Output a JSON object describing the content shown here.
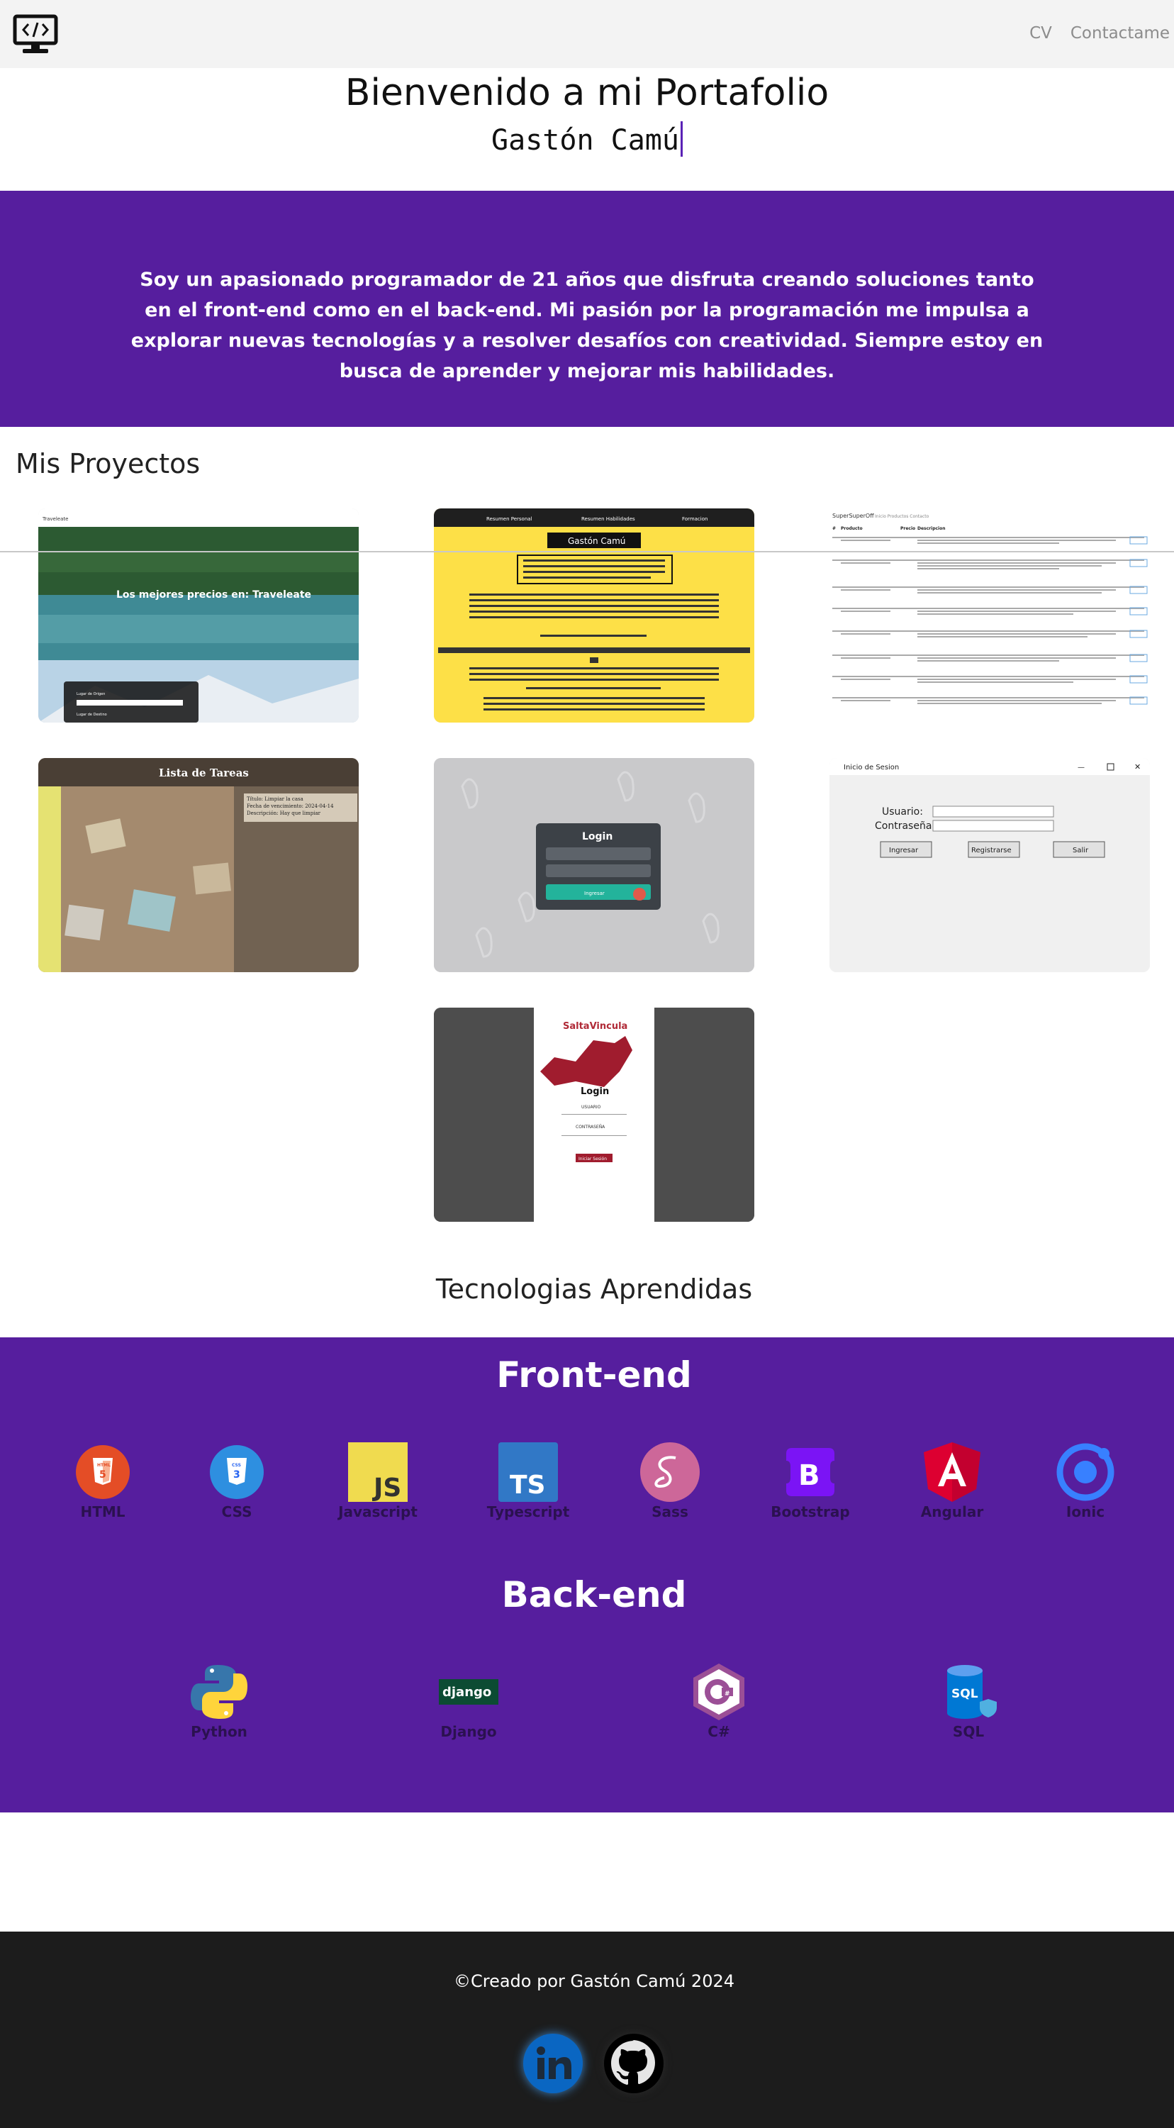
{
  "nav": {
    "logo_icon": "code-monitor-icon",
    "links": [
      "CV",
      "Contactame"
    ]
  },
  "hero": {
    "title": "Bienvenido a mi Portafolio",
    "name": "Gastón Camú"
  },
  "about": {
    "text": "Soy un apasionado programador de 21 años que disfruta creando soluciones tanto en el front-end como en el back-end. Mi pasión por la programación me impulsa a explorar nuevas tecnologías y a resolver desafíos con creatividad. Siempre estoy en busca de aprender y mejorar mis habilidades."
  },
  "projects": {
    "title": "Mis Proyectos",
    "items": [
      {
        "name": "traveleate",
        "hero_text": "Los mejores precios en: Traveleate",
        "brand": "Traveleate",
        "form_labels": [
          "Lugar de Origen",
          "Lugar de Destino"
        ]
      },
      {
        "name": "cv-page",
        "heading": "Gastón Camú",
        "tabs": [
          "Resumen Personal",
          "Resumen Habilidades",
          "Formacion"
        ]
      },
      {
        "name": "supersuperoff",
        "brand": "SuperSuperOff",
        "headers": [
          "#",
          "Producto",
          "Precio",
          "Descripcion"
        ]
      },
      {
        "name": "lista-tareas",
        "title": "Lista de Tareas",
        "fields": [
          "Título:",
          "Fecha de vencimiento:",
          "Descripción:"
        ]
      },
      {
        "name": "login-odontologia",
        "title": "Login",
        "button": "Ingresar"
      },
      {
        "name": "inicio-sesion",
        "window_title": "Inicio de Sesion",
        "labels": [
          "Usuario:",
          "Contraseña:"
        ],
        "buttons": [
          "Ingresar",
          "Registrarse",
          "Salir"
        ]
      },
      {
        "name": "saltavincula",
        "brand": "SaltaVincula",
        "title": "Login",
        "labels": [
          "USUARIO",
          "CONTRASEÑA"
        ],
        "button": "Iniciar Sesión"
      }
    ]
  },
  "tech": {
    "title": "Tecnologias Aprendidas",
    "frontend": {
      "title": "Front-end",
      "items": [
        {
          "label": "HTML",
          "icon": "html5-icon",
          "color": "#e44d26"
        },
        {
          "label": "CSS",
          "icon": "css3-icon",
          "color": "#2965f1"
        },
        {
          "label": "Javascript",
          "icon": "javascript-icon",
          "color": "#f0db4f"
        },
        {
          "label": "Typescript",
          "icon": "typescript-icon",
          "color": "#3178c6"
        },
        {
          "label": "Sass",
          "icon": "sass-icon",
          "color": "#cd6799"
        },
        {
          "label": "Bootstrap",
          "icon": "bootstrap-icon",
          "color": "#7952b3"
        },
        {
          "label": "Angular",
          "icon": "angular-icon",
          "color": "#dd0031"
        },
        {
          "label": "Ionic",
          "icon": "ionic-icon",
          "color": "#3880ff"
        }
      ]
    },
    "backend": {
      "title": "Back-end",
      "items": [
        {
          "label": "Python",
          "icon": "python-icon",
          "color": "#3776ab"
        },
        {
          "label": "Django",
          "icon": "django-icon",
          "color": "#0c4b33"
        },
        {
          "label": "C#",
          "icon": "csharp-icon",
          "color": "#9b4f96"
        },
        {
          "label": "SQL",
          "icon": "sql-database-icon",
          "color": "#0078d4"
        }
      ]
    }
  },
  "footer": {
    "text": "©Creado por Gastón Camú 2024",
    "socials": [
      {
        "icon": "linkedin-icon",
        "color": "#0a66c2"
      },
      {
        "icon": "github-icon",
        "color": "#000000"
      }
    ]
  }
}
